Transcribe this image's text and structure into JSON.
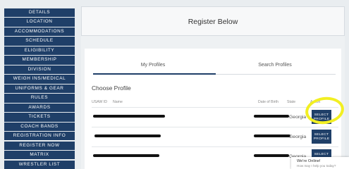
{
  "sidebar": {
    "items": [
      {
        "label": "DETAILS"
      },
      {
        "label": "LOCATION"
      },
      {
        "label": "ACCOMMODATIONS"
      },
      {
        "label": "SCHEDULE"
      },
      {
        "label": "ELIGIBILITY"
      },
      {
        "label": "MEMBERSHIP"
      },
      {
        "label": "DIVISION"
      },
      {
        "label": "WEIGH INS/MEDICAL"
      },
      {
        "label": "UNIFORMS & GEAR"
      },
      {
        "label": "RULES"
      },
      {
        "label": "AWARDS"
      },
      {
        "label": "TICKETS"
      },
      {
        "label": "COACH BANDS"
      },
      {
        "label": "REGISTRATION INFO"
      },
      {
        "label": "REGISTER NOW"
      },
      {
        "label": "MATRIX"
      },
      {
        "label": "WRESTLER LIST"
      }
    ]
  },
  "main": {
    "title": "Register Below",
    "tabs": [
      {
        "label": "My Profiles",
        "active": true
      },
      {
        "label": "Search Profiles",
        "active": false
      }
    ],
    "section_title": "Choose Profile",
    "table": {
      "headers": {
        "id": "USAW ID",
        "name": "Name",
        "dob": "Date of Birth",
        "state": "State",
        "action": "Action"
      },
      "rows": [
        {
          "state": "Georgia",
          "action": "SELECT PROFILE",
          "name_redacted": true,
          "dob_redacted": true
        },
        {
          "state": "Georgia",
          "action": "SELECT PROFILE",
          "name_redacted": true,
          "dob_redacted": true
        },
        {
          "state": "Georgia",
          "action": "SELECT PROFILE",
          "name_redacted": true,
          "dob_redacted": true
        }
      ]
    }
  },
  "chat": {
    "label": "We're Online!",
    "subtitle": "How may I help you today?"
  },
  "colors": {
    "brand": "#1f3f68",
    "highlight": "#f2ef22",
    "redaction": "#121212"
  }
}
